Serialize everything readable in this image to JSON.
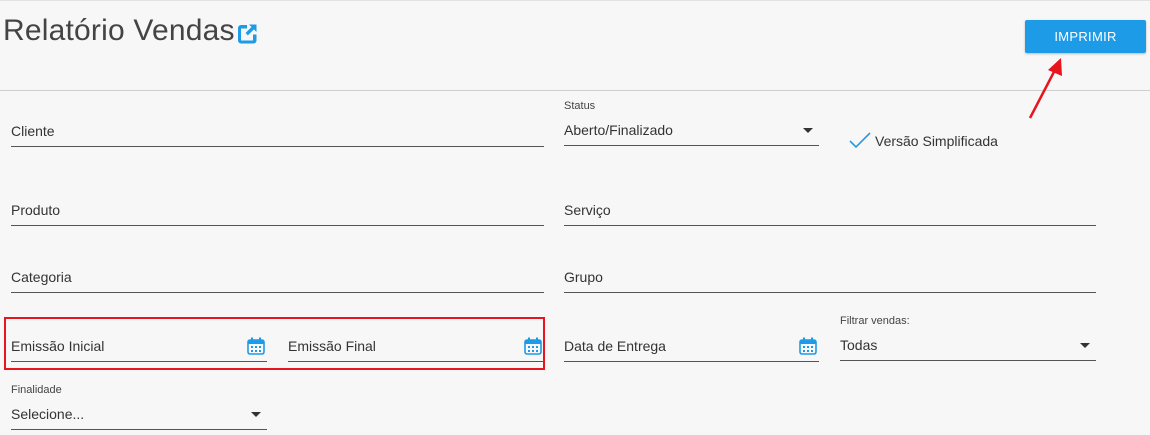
{
  "header": {
    "title": "Relatório Vendas",
    "print_label": "IMPRIMIR"
  },
  "form": {
    "cliente": {
      "label": "Cliente"
    },
    "status": {
      "label": "Status",
      "value": "Aberto/Finalizado"
    },
    "versao": {
      "label": "Versão Simplificada",
      "checked": true
    },
    "produto": {
      "label": "Produto"
    },
    "servico": {
      "label": "Serviço"
    },
    "categoria": {
      "label": "Categoria"
    },
    "grupo": {
      "label": "Grupo"
    },
    "emissao_inicial": {
      "label": "Emissão Inicial"
    },
    "emissao_final": {
      "label": "Emissão Final"
    },
    "data_entrega": {
      "label": "Data de Entrega"
    },
    "filtrar_vendas": {
      "label": "Filtrar vendas:",
      "value": "Todas"
    },
    "finalidade": {
      "label": "Finalidade",
      "value": "Selecione..."
    }
  },
  "icons": {
    "external_link": "external-link-icon",
    "calendar": "calendar-icon",
    "checkmark": "checkmark-icon",
    "dropdown": "chevron-down-icon"
  },
  "colors": {
    "primary": "#1e9be6",
    "annotation": "#e8141e",
    "checkmark": "#2a9be0"
  }
}
